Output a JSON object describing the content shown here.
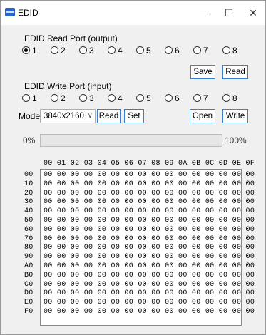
{
  "window": {
    "title": "EDID",
    "minimize": "—",
    "maximize": "☐",
    "close": "✕"
  },
  "read_port": {
    "label": "EDID Read Port (output)",
    "options": [
      "1",
      "2",
      "3",
      "4",
      "5",
      "6",
      "7",
      "8"
    ],
    "selected": "1",
    "save_button": "Save",
    "read_button": "Read"
  },
  "write_port": {
    "label": "EDID Write Port (input)",
    "options": [
      "1",
      "2",
      "3",
      "4",
      "5",
      "6",
      "7",
      "8"
    ],
    "selected": ""
  },
  "mode": {
    "label": "Mode",
    "value": "3840x2160",
    "read_button": "Read",
    "set_button": "Set",
    "open_button": "Open",
    "write_button": "Write"
  },
  "progress": {
    "left_label": "0%",
    "right_label": "100%",
    "fraction": 0
  },
  "hex_table": {
    "columns": [
      "00",
      "01",
      "02",
      "03",
      "04",
      "05",
      "06",
      "07",
      "08",
      "09",
      "0A",
      "0B",
      "0C",
      "0D",
      "0E",
      "0F"
    ],
    "rows": [
      "00",
      "10",
      "20",
      "30",
      "40",
      "50",
      "60",
      "70",
      "80",
      "90",
      "A0",
      "B0",
      "C0",
      "D0",
      "E0",
      "F0"
    ],
    "cell_value": "00"
  }
}
